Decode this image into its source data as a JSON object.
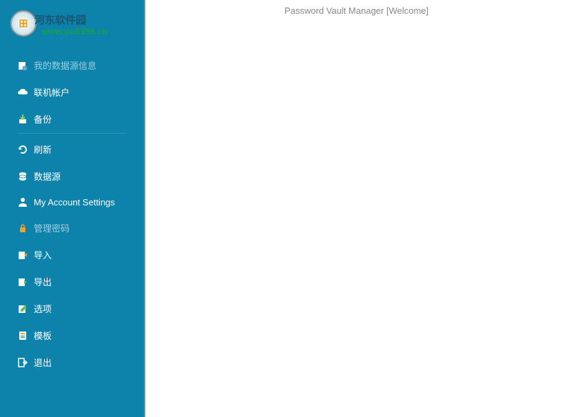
{
  "header": {
    "title": "Password Vault Manager [Welcome]"
  },
  "watermark": {
    "site_name": "河东软件园",
    "url": "www.pc0359.cn"
  },
  "sidebar": {
    "items": [
      {
        "label": "我的数据源信息",
        "icon": "datasource-info-icon",
        "dim": true
      },
      {
        "label": "联机帐户",
        "icon": "cloud-icon"
      },
      {
        "label": "备份",
        "icon": "backup-icon",
        "divider": true
      },
      {
        "label": "刷新",
        "icon": "refresh-icon"
      },
      {
        "label": "数据源",
        "icon": "database-icon"
      },
      {
        "label": "My Account Settings",
        "icon": "user-icon"
      },
      {
        "label": "管理密码",
        "icon": "lock-icon",
        "dim": true
      },
      {
        "label": "导入",
        "icon": "import-icon"
      },
      {
        "label": "导出",
        "icon": "export-icon"
      },
      {
        "label": "选项",
        "icon": "options-icon"
      },
      {
        "label": "模板",
        "icon": "template-icon"
      },
      {
        "label": "退出",
        "icon": "exit-icon"
      }
    ]
  },
  "annotation": {
    "arrow_target": "选项"
  }
}
